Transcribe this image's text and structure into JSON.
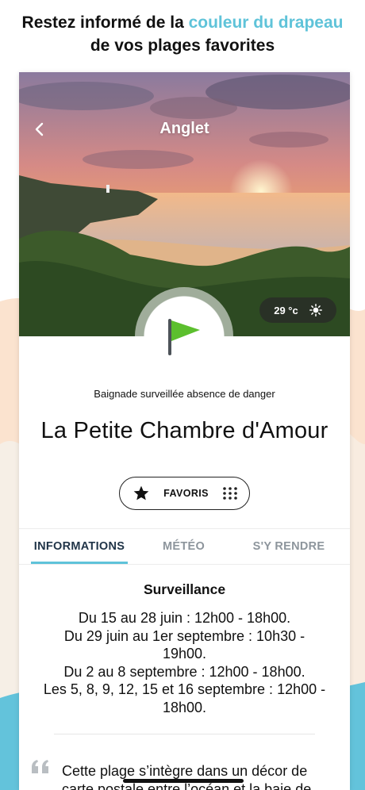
{
  "headline": {
    "line1_before": "Restez informé de la ",
    "line1_accent": "couleur du drapeau",
    "line2": "de vos plages favorites"
  },
  "hero": {
    "location": "Anglet",
    "temperature": "29 °c",
    "weather_icon": "sun-icon",
    "back_icon": "chevron-left-icon"
  },
  "flag": {
    "color": "#5cbf2e",
    "icon": "flag-icon"
  },
  "beach": {
    "status": "Baignade surveillée absence de danger",
    "name": "La Petite Chambre d'Amour"
  },
  "favorite_button": {
    "label": "FAVORIS",
    "icon": "star-icon",
    "handle_icon": "grip-dots-icon"
  },
  "tabs": [
    {
      "label": "INFORMATIONS",
      "active": true
    },
    {
      "label": "MÉTÉO",
      "active": false
    },
    {
      "label": "S'Y RENDRE",
      "active": false
    }
  ],
  "surveillance": {
    "title": "Surveillance",
    "lines": [
      "Du 15 au 28 juin : 12h00 - 18h00.",
      "Du 29 juin au 1er septembre : 10h30 -",
      "19h00.",
      "Du 2 au 8 septembre : 12h00 - 18h00.",
      "Les 5, 8, 9, 12, 15 et 16 septembre : 12h00 -",
      "18h00."
    ]
  },
  "description": {
    "icon": "quote-icon",
    "text": "Cette plage s’intègre dans un décor de carte postale entre l’océan et la baie de"
  },
  "colors": {
    "accent": "#5fc3d9",
    "tab_active": "#1f3347",
    "tab_inactive": "#8d959c",
    "flag_green": "#5cbf2e"
  }
}
